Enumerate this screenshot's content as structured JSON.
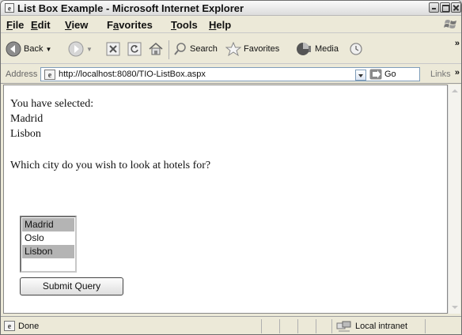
{
  "window": {
    "title": "List Box Example - Microsoft Internet Explorer"
  },
  "menu": {
    "items": [
      {
        "first": "F",
        "rest": "ile"
      },
      {
        "first": "E",
        "rest": "dit"
      },
      {
        "first": "V",
        "rest": "iew"
      },
      {
        "first": "Fa",
        "rest": "vorites",
        "u": "a"
      },
      {
        "first": "T",
        "rest": "ools"
      },
      {
        "first": "H",
        "rest": "elp"
      }
    ]
  },
  "toolbar": {
    "back_label": "Back",
    "search_label": "Search",
    "favorites_label": "Favorites",
    "media_label": "Media"
  },
  "address": {
    "label": "Address",
    "url": "http://localhost:8080/TIO-ListBox.aspx",
    "go_label": "Go",
    "links_label": "Links"
  },
  "content": {
    "selected_heading": "You have selected:",
    "selected_items": [
      "Madrid",
      "Lisbon"
    ],
    "question": "Which city do you wish to look at hotels for?",
    "listbox_options": [
      {
        "label": "Madrid",
        "selected": true
      },
      {
        "label": "Oslo",
        "selected": false
      },
      {
        "label": "Lisbon",
        "selected": true
      }
    ],
    "submit_label": "Submit Query"
  },
  "status": {
    "text": "Done",
    "zone": "Local intranet"
  }
}
